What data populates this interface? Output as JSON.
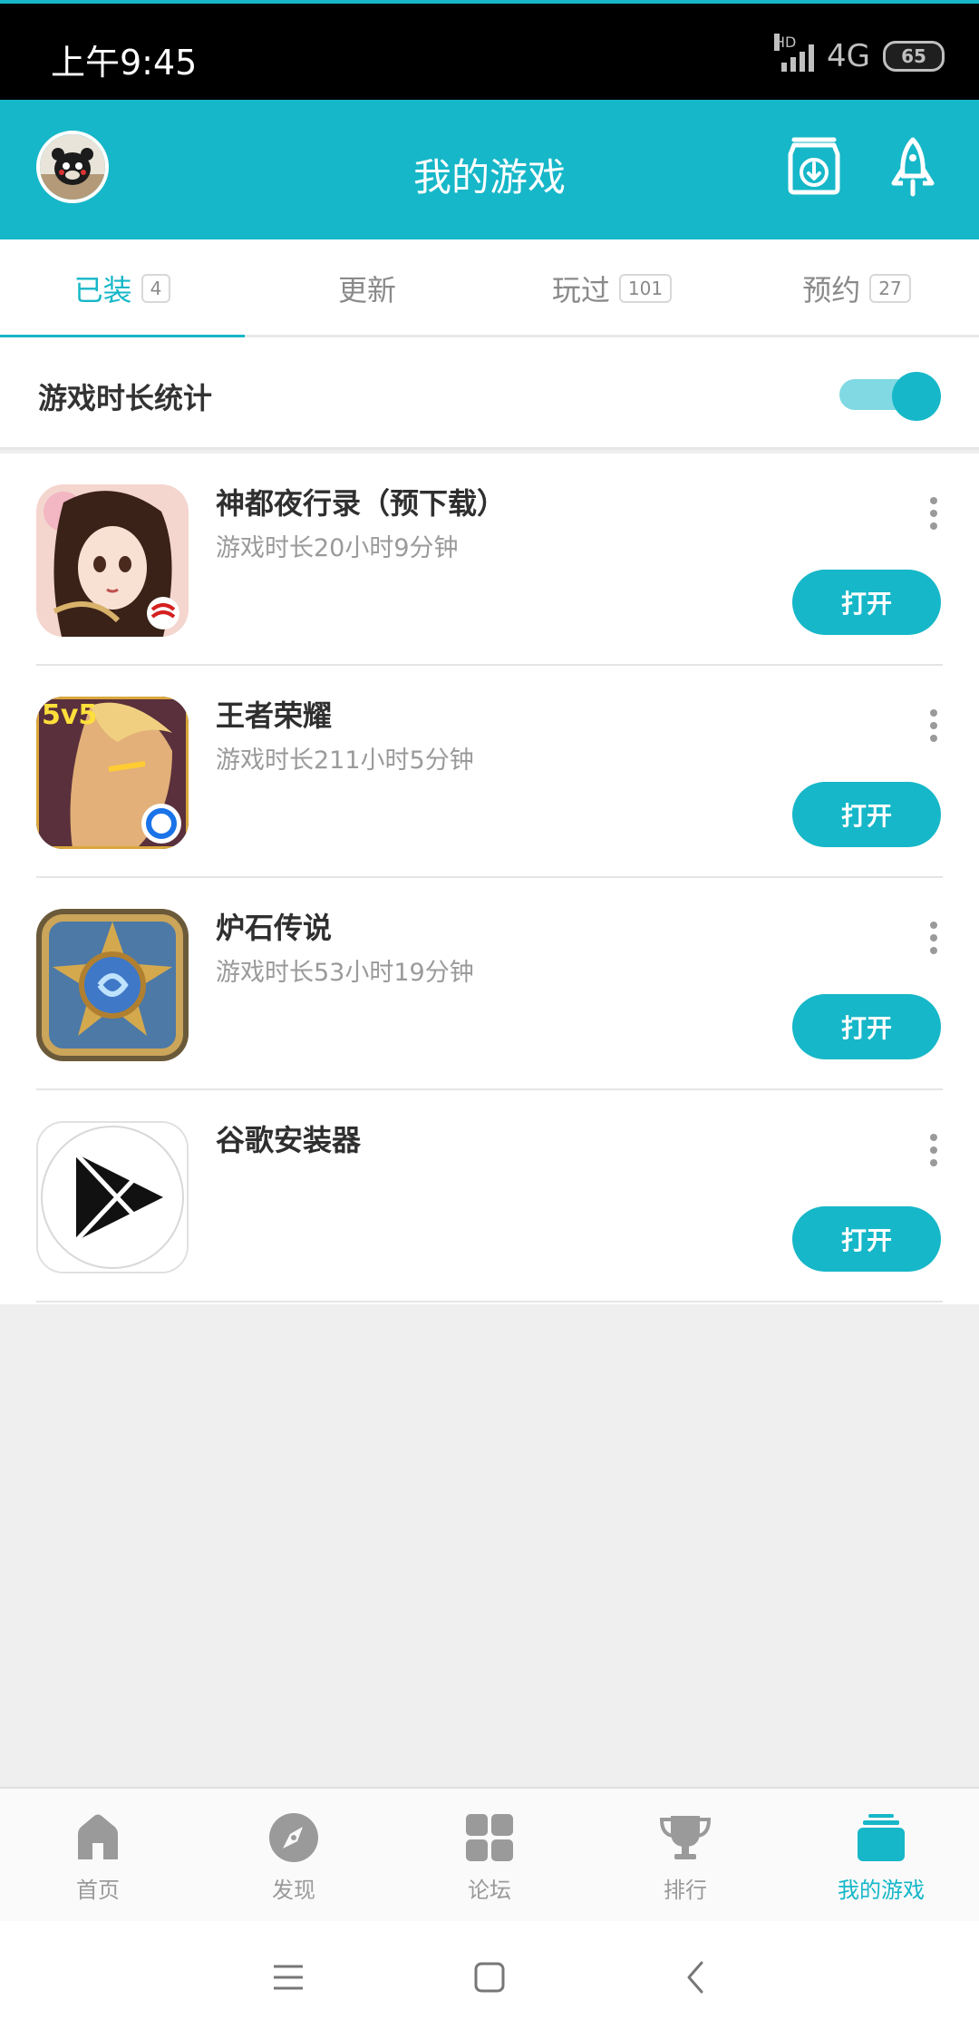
{
  "status_bar": {
    "time": "上午9:45",
    "hd": "HD",
    "network": "4G",
    "battery": "65"
  },
  "header": {
    "title": "我的游戏",
    "icons": [
      "avatar",
      "download-icon",
      "rocket-icon"
    ]
  },
  "tabs": [
    {
      "label": "已装",
      "count": "4",
      "active": true
    },
    {
      "label": "更新",
      "count": "",
      "active": false
    },
    {
      "label": "玩过",
      "count": "101",
      "active": false
    },
    {
      "label": "预约",
      "count": "27",
      "active": false
    }
  ],
  "stats": {
    "label": "游戏时长统计",
    "toggle_on": true
  },
  "games": [
    {
      "name": "神都夜行录（预下载）",
      "time": "游戏时长20小时9分钟",
      "button": "打开",
      "icon": "game-icon-shendu"
    },
    {
      "name": "王者荣耀",
      "time": "游戏时长211小时5分钟",
      "button": "打开",
      "icon": "game-icon-wangzhe"
    },
    {
      "name": "炉石传说",
      "time": "游戏时长53小时19分钟",
      "button": "打开",
      "icon": "game-icon-hearthstone"
    },
    {
      "name": "谷歌安装器",
      "time": "",
      "button": "打开",
      "icon": "game-icon-google-installer"
    }
  ],
  "bottom_nav": [
    {
      "label": "首页",
      "icon": "home-icon",
      "active": false
    },
    {
      "label": "发现",
      "icon": "compass-icon",
      "active": false
    },
    {
      "label": "论坛",
      "icon": "grid-icon",
      "active": false
    },
    {
      "label": "排行",
      "icon": "trophy-icon",
      "active": false
    },
    {
      "label": "我的游戏",
      "icon": "stack-icon",
      "active": true
    }
  ],
  "system_nav": [
    "menu-icon",
    "home-square-icon",
    "back-icon"
  ],
  "colors": {
    "accent": "#16b7c8",
    "status_bar": "#000000",
    "background": "#efefef"
  }
}
